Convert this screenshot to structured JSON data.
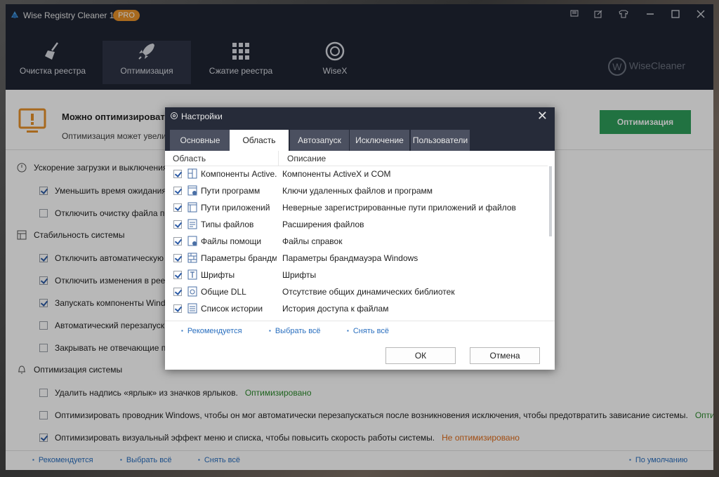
{
  "window": {
    "title": "Wise Registry Cleaner 11",
    "badge": "PRO"
  },
  "nav": [
    {
      "label": "Очистка реестра",
      "icon": "broom-icon"
    },
    {
      "label": "Оптимизация",
      "icon": "rocket-icon"
    },
    {
      "label": "Сжатие реестра",
      "icon": "grid-icon"
    },
    {
      "label": "WiseX",
      "icon": "wisex-icon"
    }
  ],
  "brand": "WiseCleaner",
  "brand_letter": "W",
  "banner": {
    "title": "Можно оптимизироват",
    "subtitle": "Оптимизация может увеличи",
    "button": "Оптимизация"
  },
  "sections": [
    {
      "title": "Ускорение загрузки и выключения",
      "icon": "power-icon"
    },
    {
      "title": "Стабильность системы",
      "icon": "stability-icon"
    },
    {
      "title": "Оптимизация системы",
      "icon": "bell-icon"
    }
  ],
  "rows": [
    {
      "label": "Уменьшить время ожидания от",
      "checked": true
    },
    {
      "label": "Отключить очистку файла под",
      "checked": false
    },
    {
      "label": "Отключить автоматическую п",
      "checked": true
    },
    {
      "label": "Отключить изменения в реест",
      "checked": true
    },
    {
      "label": "Запускать компоненты Window",
      "checked": true
    },
    {
      "label": "Автоматический перезапуск пр",
      "checked": false
    },
    {
      "label": "Закрывать не отвечающие про",
      "checked": false
    },
    {
      "label": "Удалить надпись «ярлык» из значков ярлыков.",
      "checked": false,
      "status": "Оптимизировано"
    },
    {
      "label": "Оптимизировать проводник Windows, чтобы он мог автоматически перезапускаться после возникновения исключения, чтобы предотвратить зависание системы.",
      "checked": false,
      "status": "Оптимизиров..."
    },
    {
      "label": "Оптимизировать визуальный эффект меню и списка, чтобы повысить скорость работы системы.",
      "checked": true,
      "status": "Не оптимизировано"
    }
  ],
  "footer": {
    "recommended": "Рекомендуется",
    "select_all": "Выбрать всё",
    "deselect_all": "Снять всё",
    "default": "По умолчанию"
  },
  "dialog": {
    "title": "Настройки",
    "close": "✕",
    "tabs": [
      "Основные",
      "Область",
      "Автозапуск",
      "Исключение",
      "Пользователи"
    ],
    "active_tab": "Область",
    "col_area": "Область",
    "col_desc": "Описание",
    "items": [
      {
        "name": "Компоненты Active...",
        "desc": "Компоненты ActiveX и COM",
        "checked": true
      },
      {
        "name": "Пути программ",
        "desc": "Ключи удаленных файлов и программ",
        "checked": true
      },
      {
        "name": "Пути приложений",
        "desc": "Неверные зарегистрированные пути приложений и файлов",
        "checked": true
      },
      {
        "name": "Типы файлов",
        "desc": "Расширения файлов",
        "checked": true
      },
      {
        "name": "Файлы помощи",
        "desc": "Файлы справок",
        "checked": true
      },
      {
        "name": "Параметры брандм...",
        "desc": "Параметры брандмауэра Windows",
        "checked": true
      },
      {
        "name": "Шрифты",
        "desc": "Шрифты",
        "checked": true
      },
      {
        "name": "Общие DLL",
        "desc": "Отсутствие общих динамических библиотек",
        "checked": true
      },
      {
        "name": "Список истории",
        "desc": "История доступа к файлам",
        "checked": true
      }
    ],
    "links": {
      "recommended": "Рекомендуется",
      "select_all": "Выбрать всё",
      "deselect_all": "Снять всё"
    },
    "ok": "ОК",
    "cancel": "Отмена"
  }
}
